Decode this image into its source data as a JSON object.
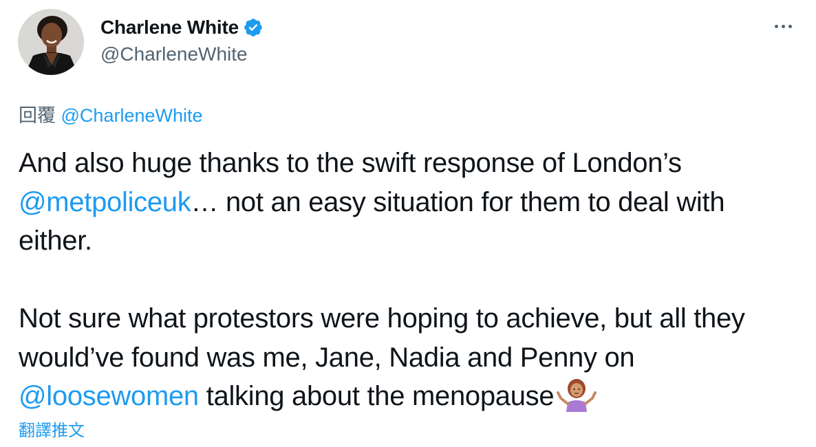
{
  "author": {
    "display_name": "Charlene White",
    "handle": "@CharleneWhite",
    "verified": true
  },
  "menu": {
    "icon": "more-horizontal-icon"
  },
  "reply_to": {
    "prefix": "回覆",
    "mention": "@CharleneWhite"
  },
  "tweet": {
    "p1_text_a": "And also huge thanks to the swift response of London’s ",
    "p1_mention": "@metpoliceuk",
    "p1_text_b": "… not an easy situation for them to deal with either.",
    "p2_text_a": "Not sure what protestors were hoping to achieve, but all they would’ve found was me, Jane, Nadia and Penny on ",
    "p2_mention": "@loosewomen",
    "p2_text_b": " talking about the menopause",
    "emoji": "person-shrugging-emoji"
  },
  "translate_label": "翻譯推文",
  "colors": {
    "link": "#1d9bf0",
    "secondary_text": "#536471",
    "primary_text": "#0f1419",
    "verified_badge": "#1d9bf0"
  }
}
